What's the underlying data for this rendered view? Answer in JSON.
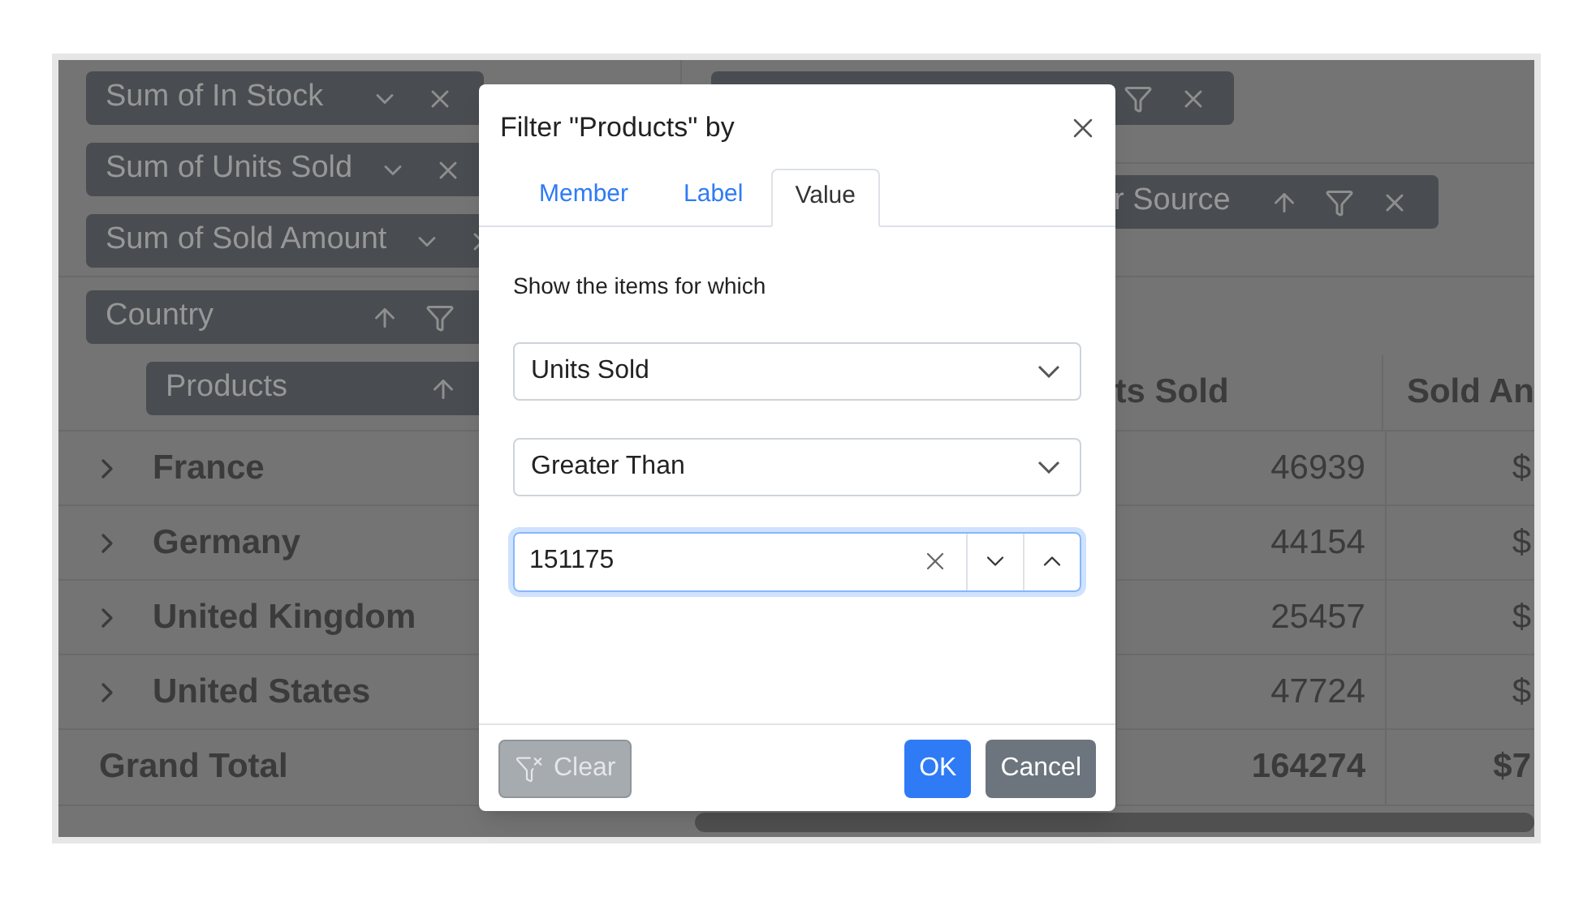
{
  "pivot": {
    "value_chips": [
      {
        "label": "Sum of In Stock"
      },
      {
        "label": "Sum of Units Sold"
      },
      {
        "label": "Sum of Sold Amount"
      }
    ],
    "column_chip": {
      "label": "r Source"
    },
    "row_chips": [
      {
        "label": "Country"
      },
      {
        "label": "Products"
      }
    ],
    "columns": [
      {
        "label": "ts Sold"
      },
      {
        "label": "Sold An"
      }
    ],
    "rows": [
      {
        "label": "France",
        "expanded": false,
        "units": "46939",
        "amount": "$"
      },
      {
        "label": "Germany",
        "expanded": false,
        "units": "44154",
        "amount": "$"
      },
      {
        "label": "United Kingdom",
        "expanded": false,
        "units": "25457",
        "amount": "$"
      },
      {
        "label": "United States",
        "expanded": false,
        "units": "47724",
        "amount": "$"
      }
    ],
    "grand_total": {
      "label": "Grand Total",
      "units": "164274",
      "amount": "$7"
    }
  },
  "dialog": {
    "title": "Filter \"Products\" by",
    "tabs": [
      {
        "label": "Member",
        "selected": false
      },
      {
        "label": "Label",
        "selected": false
      },
      {
        "label": "Value",
        "selected": true
      }
    ],
    "prompt": "Show the items for which",
    "field": "Units Sold",
    "condition": "Greater Than",
    "value": "151175",
    "buttons": [
      {
        "label": "Clear",
        "kind": "clear",
        "disabled": true
      },
      {
        "label": "OK",
        "kind": "primary",
        "disabled": false
      },
      {
        "label": "Cancel",
        "kind": "secondary",
        "disabled": false
      }
    ]
  }
}
